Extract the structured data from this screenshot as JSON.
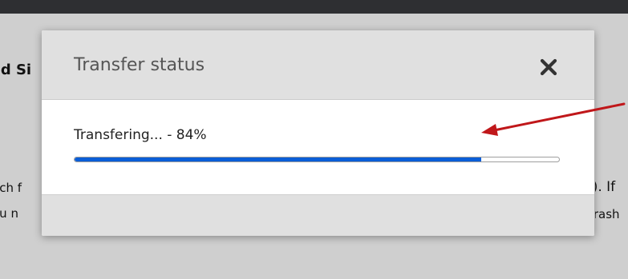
{
  "background": {
    "heading_fragment": "nd Si",
    "left_lines": [
      "ach f",
      "ou n"
    ],
    "right_lines": [
      "l). If",
      "trash"
    ]
  },
  "dialog": {
    "title": "Transfer status",
    "close_icon": "close-x-icon",
    "progress": {
      "label": "Transfering... - 84%",
      "percent": 84
    }
  },
  "annotation": {
    "arrow_icon": "red-arrow-icon",
    "color": "#c0171a"
  },
  "colors": {
    "progress_fill": "#0b5ed7",
    "header_bg": "#e0e0e0",
    "top_bar": "#2e2f32"
  }
}
